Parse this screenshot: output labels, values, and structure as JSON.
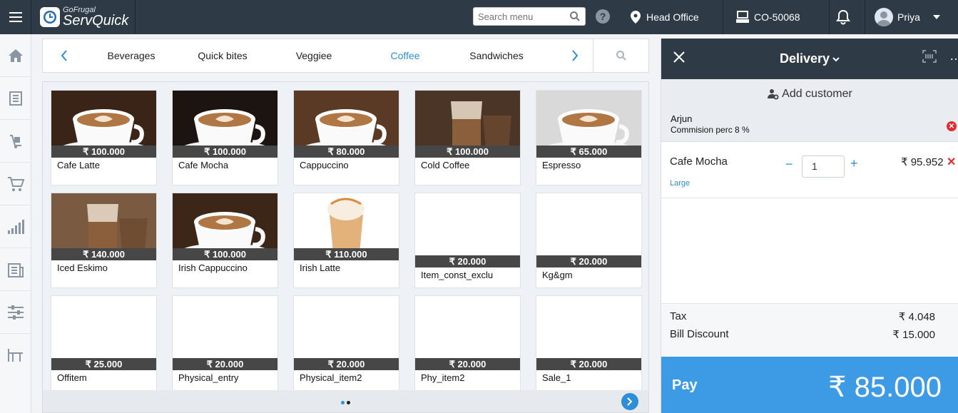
{
  "header": {
    "brand_small": "GoFrugal",
    "brand_name": "ServQuick",
    "search_placeholder": "Search menu",
    "location": "Head Office",
    "counter": "CO-50068",
    "user": "Priya"
  },
  "categories": {
    "items": [
      "Beverages",
      "Quick bites",
      "Veggiee",
      "Coffee",
      "Sandwiches"
    ],
    "active": "Coffee"
  },
  "products": [
    {
      "name": "Cafe Latte",
      "price": "₹ 100.000",
      "image": "latte"
    },
    {
      "name": "Cafe Mocha",
      "price": "₹ 100.000",
      "image": "mocha"
    },
    {
      "name": "Cappuccino",
      "price": "₹ 80.000",
      "image": "cappuccino"
    },
    {
      "name": "Cold Coffee",
      "price": "₹ 100.000",
      "image": "cold"
    },
    {
      "name": "Espresso",
      "price": "₹ 65.000",
      "image": "espresso"
    },
    {
      "name": "Iced Eskimo",
      "price": "₹ 140.000",
      "image": "iced"
    },
    {
      "name": "Irish Cappuccino",
      "price": "₹ 100.000",
      "image": "irishcap"
    },
    {
      "name": "Irish Latte",
      "price": "₹ 110.000",
      "image": "irishlatte"
    },
    {
      "name": "Item_const_exclu",
      "price": "₹ 20.000",
      "image": ""
    },
    {
      "name": "Kg&gm",
      "price": "₹ 20.000",
      "image": ""
    },
    {
      "name": "Offitem",
      "price": "₹ 25.000",
      "image": ""
    },
    {
      "name": "Physical_entry",
      "price": "₹ 20.000",
      "image": ""
    },
    {
      "name": "Physical_item2",
      "price": "₹ 20.000",
      "image": ""
    },
    {
      "name": "Phy_item2",
      "price": "₹ 20.000",
      "image": ""
    },
    {
      "name": "Sale_1",
      "price": "₹ 20.000",
      "image": ""
    }
  ],
  "order": {
    "mode": "Delivery",
    "add_customer": "Add customer",
    "agent_name": "Arjun",
    "agent_commission": "Commision perc 8 %",
    "line": {
      "name": "Cafe Mocha",
      "variant": "Large",
      "qty": "1",
      "amount": "₹ 95.952"
    },
    "tax_label": "Tax",
    "tax_value": "₹ 4.048",
    "discount_label": "Bill Discount",
    "discount_value": "₹ 15.000",
    "pay_label": "Pay",
    "pay_amount": "₹ 85.000"
  },
  "colors": {
    "topbar": "#2f3a47",
    "accent": "#2f8fd6",
    "pay": "#3d9be6",
    "danger": "#e02d2d"
  }
}
